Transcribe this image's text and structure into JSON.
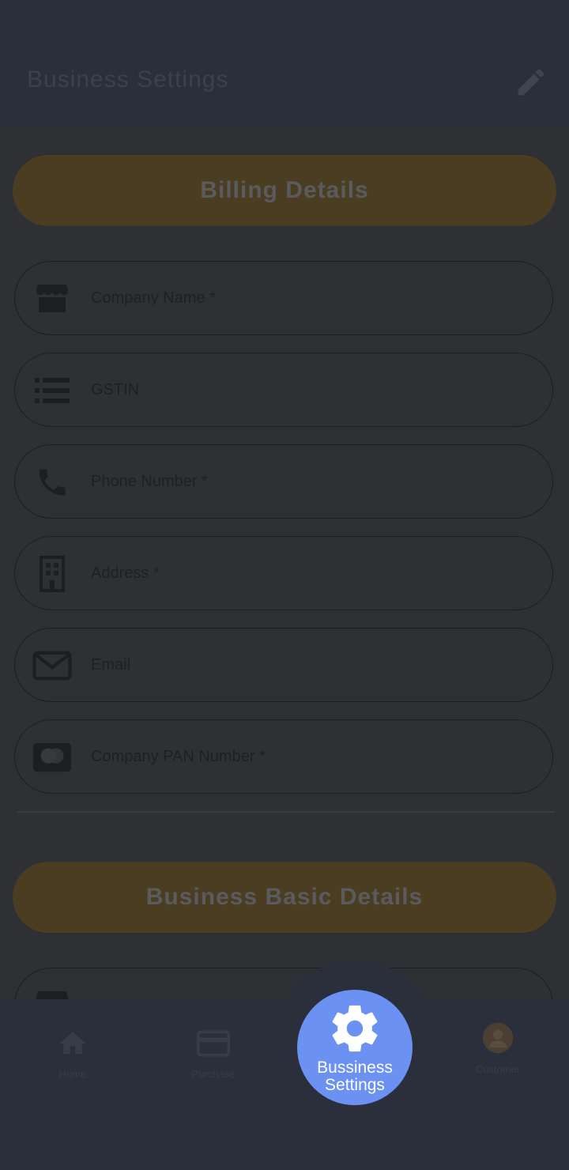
{
  "appbar": {
    "title": "Business Settings",
    "edit_icon": "pencil-icon"
  },
  "sections": {
    "billing_title": "Billing Details",
    "basic_title": "Business Basic Details"
  },
  "billing_fields": [
    {
      "placeholder": "Company Name *",
      "icon": "store-icon"
    },
    {
      "placeholder": "GSTIN",
      "icon": "list-icon"
    },
    {
      "placeholder": "Phone Number *",
      "icon": "phone-icon"
    },
    {
      "placeholder": "Address *",
      "icon": "building-icon"
    },
    {
      "placeholder": "Email",
      "icon": "mail-icon"
    },
    {
      "placeholder": "Company PAN Number *",
      "icon": "card-icon"
    }
  ],
  "basic_fields": [
    {
      "placeholder": "",
      "icon": "store-icon"
    }
  ],
  "bottom_nav": {
    "items": [
      {
        "label": "Home",
        "icon": "home-icon"
      },
      {
        "label": "Purchase",
        "icon": "card-icon"
      },
      {
        "label": "Customer",
        "icon": "avatar-icon"
      }
    ],
    "fab": {
      "label": "Bussiness Settings",
      "icon": "gear-icon"
    }
  },
  "colors": {
    "overlay_dim": "#2b2f3a",
    "accent_pill": "#4a3d22",
    "fab": "#6b92f2"
  }
}
